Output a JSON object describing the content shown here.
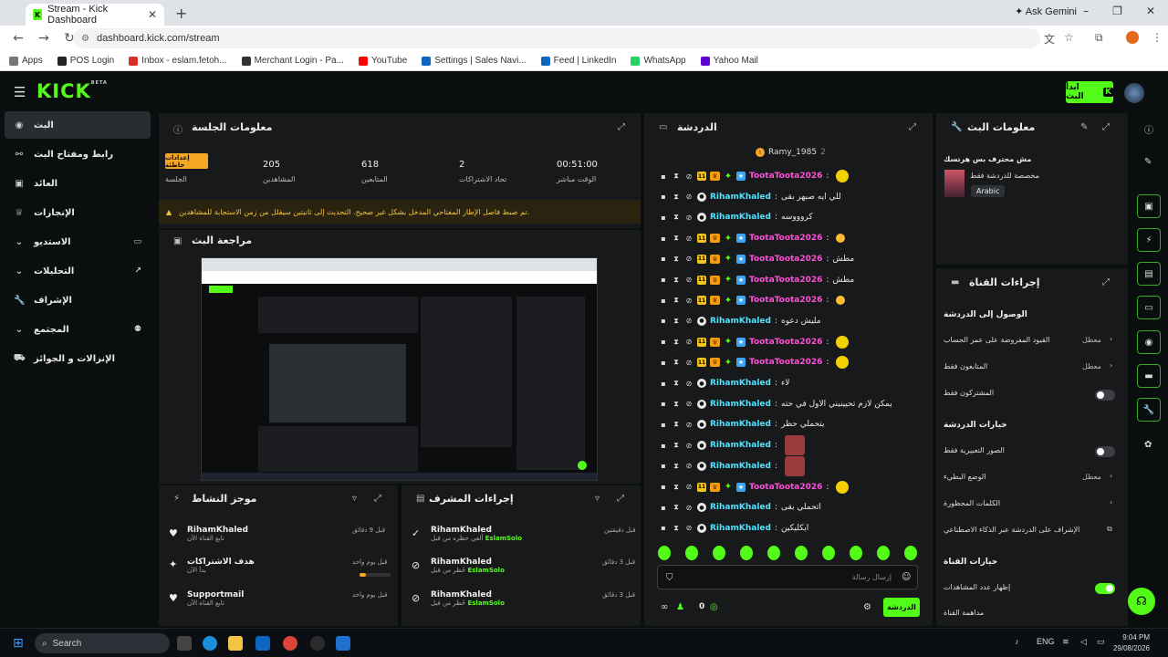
{
  "browser": {
    "tab_title": "Stream - Kick Dashboard",
    "ask_gemini": "Ask Gemini",
    "url": "dashboard.kick.com/stream",
    "bookmarks": [
      "Apps",
      "POS Login",
      "Inbox - eslam.fetoh...",
      "Merchant Login - Pa...",
      "YouTube",
      "Settings | Sales Navi...",
      "Feed | LinkedIn",
      "WhatsApp",
      "Yahoo Mail"
    ]
  },
  "app": {
    "logo": "KICK",
    "logo_tag": "BETA",
    "go_live": "ابدأ البث"
  },
  "sidebar": {
    "items": [
      {
        "label": "البث",
        "icon": "broadcast-icon"
      },
      {
        "label": "رابط ومفتاح البث",
        "icon": "link-icon"
      },
      {
        "label": "العائد",
        "icon": "revenue-icon"
      },
      {
        "label": "الإنجازات",
        "icon": "trophy-icon"
      },
      {
        "label": "الاستديو",
        "icon": "studio-icon"
      },
      {
        "label": "التحليلات",
        "icon": "analytics-icon"
      },
      {
        "label": "الإشراف",
        "icon": "wrench-icon"
      },
      {
        "label": "المجتمع",
        "icon": "community-icon"
      },
      {
        "label": "الإنزالات و الجوائز",
        "icon": "gift-icon"
      }
    ]
  },
  "session": {
    "title": "معلومات الجلسة",
    "settings_badge": "إعدادات خاطئة",
    "session_label": "الجلسة",
    "stats": [
      {
        "value": "205",
        "label": "المشاهدين"
      },
      {
        "value": "618",
        "label": "المتابعين"
      },
      {
        "value": "2",
        "label": "تحاد الاشتراكات"
      },
      {
        "value": "00:51:00",
        "label": "الوقت مباشر"
      }
    ],
    "warning": "تم ضبط فاصل الإطار المفتاحي المدخل بشكل غير صحيح. التحديث إلى ثانيتين سيقلل من زمن الاستجابة للمشاهدين."
  },
  "preview": {
    "title": "مراجعة البث"
  },
  "activity": {
    "title": "موجز النشاط",
    "items": [
      {
        "name": "RihamKhaled",
        "sub": "تابع القناة الآن",
        "time": "قبل 9 دقائق"
      },
      {
        "name": "هدف الاشتراكات",
        "sub": "بدأ الآن",
        "time": "قبل يوم واحد"
      },
      {
        "name": "Supportmail",
        "sub": "تابع القناة الآن",
        "time": "قبل يوم واحد"
      }
    ]
  },
  "mod_actions": {
    "title": "إجراءات المشرف",
    "items": [
      {
        "name": "RihamKhaled",
        "sub": "ألغي حظره من قبل",
        "by": "EslamSolo",
        "time": "قبل دقيقتين"
      },
      {
        "name": "RihamKhaled",
        "sub": "حُظر من قبل",
        "by": "EslamSolo",
        "time": "قبل 3 دقائق"
      },
      {
        "name": "RihamKhaled",
        "sub": "حُظر من قبل",
        "by": "EslamSolo",
        "time": "قبل 3 دقائق"
      }
    ]
  },
  "chat": {
    "title": "الدردشة",
    "pinned_user": "Ramy_1985",
    "pinned_count": "2",
    "messages": [
      {
        "user": "TootaToota2026",
        "text": "",
        "color": "#ff4fd8"
      },
      {
        "user": "RihamKhaled",
        "text": "للي ايه صبهر بقى",
        "color": "#4fe3ff"
      },
      {
        "user": "RihamKhaled",
        "text": "كروووسه",
        "color": "#4fe3ff"
      },
      {
        "user": "TootaToota2026",
        "text": "",
        "color": "#ff4fd8"
      },
      {
        "user": "TootaToota2026",
        "text": "مطش",
        "color": "#ff4fd8"
      },
      {
        "user": "TootaToota2026",
        "text": "مطش",
        "color": "#ff4fd8"
      },
      {
        "user": "TootaToota2026",
        "text": "",
        "color": "#ff4fd8"
      },
      {
        "user": "RihamKhaled",
        "text": "مليش دعوه",
        "color": "#4fe3ff"
      },
      {
        "user": "TootaToota2026",
        "text": "",
        "color": "#ff4fd8"
      },
      {
        "user": "TootaToota2026",
        "text": "",
        "color": "#ff4fd8"
      },
      {
        "user": "RihamKhaled",
        "text": "لاء",
        "color": "#4fe3ff"
      },
      {
        "user": "RihamKhaled",
        "text": "يمكن لازم تحيينيني الاول في حته",
        "color": "#4fe3ff"
      },
      {
        "user": "RihamKhaled",
        "text": "يتحملي حظر",
        "color": "#4fe3ff"
      },
      {
        "user": "RihamKhaled",
        "text": "",
        "color": "#4fe3ff"
      },
      {
        "user": "RihamKhaled",
        "text": "",
        "color": "#4fe3ff"
      },
      {
        "user": "TootaToota2026",
        "text": "",
        "color": "#ff4fd8"
      },
      {
        "user": "RihamKhaled",
        "text": "اتحملي بقى",
        "color": "#4fe3ff"
      },
      {
        "user": "RihamKhaled",
        "text": "ايكليكين",
        "color": "#4fe3ff"
      }
    ],
    "input_placeholder": "إرسال رسالة",
    "count": "0",
    "send_label": "الدردشة"
  },
  "stream_info": {
    "title": "معلومات البث",
    "stream_title": "مش محترف بس هرتسك",
    "category": "مخصصة للدردشة فقط",
    "language": "Arabic"
  },
  "channel_actions": {
    "title": "إجراءات القناة",
    "chat_access_title": "الوصول إلى الدردشة",
    "chat_access": [
      {
        "label": "القيود المفروضة على عمر الحساب",
        "value": "معطل"
      },
      {
        "label": "المتابعون فقط",
        "value": "معطل"
      },
      {
        "label": "المشتركون فقط",
        "value": ""
      }
    ],
    "chat_options_title": "خيارات الدردشة",
    "chat_options": [
      {
        "label": "الصور التعبيرية فقط",
        "value": ""
      },
      {
        "label": "الوضع البطيء",
        "value": "معطل"
      },
      {
        "label": "الكلمات المحظورة",
        "value": ""
      },
      {
        "label": "الإشراف على الدردشة عبر الذكاء الاصطناعي",
        "value": ""
      }
    ],
    "channel_options_title": "خيارات القناة",
    "channel_options": [
      {
        "label": "إظهار عدد المشاهدات",
        "value": ""
      },
      {
        "label": "مداهمة القناة",
        "value": ""
      }
    ]
  },
  "taskbar": {
    "search": "Search",
    "lang": "ENG",
    "time": "9:04 PM",
    "date": "29/08/2026"
  }
}
